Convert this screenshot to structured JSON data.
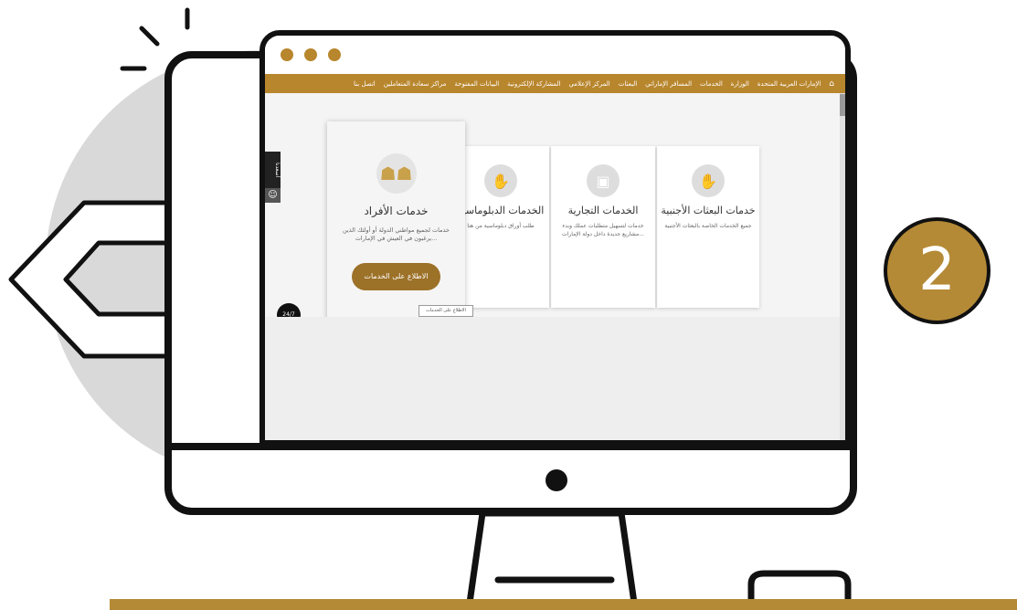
{
  "step_number": "2",
  "nav": {
    "items": [
      "الإمارات العربية المتحدة",
      "الوزارة",
      "الخدمات",
      "المسافر الإماراتي",
      "البعثات",
      "المركز الإعلامي",
      "المشاركة الإلكترونية",
      "البيانات المفتوحة",
      "مراكز سعادة المتعاملين",
      "اتصل بنا"
    ]
  },
  "side_tab_label": "أسعدنا",
  "badge_label": "24/7",
  "cards": [
    {
      "title": "خدمات البعثات الأجنبية",
      "desc": "جميع الخدمات الخاصة بالبعثات الأجنبية",
      "icon": "handshake-icon"
    },
    {
      "title": "الخدمات التجارية",
      "desc": "خدمات لتسهيل متطلبات عملك وبدء مشاريع جديدة داخل دولة الإمارات...",
      "icon": "briefcase-icon"
    },
    {
      "title": "الخدمات الدبلوماسية",
      "desc": "طلب أوراق دبلوماسية من هنا",
      "icon": "handshake-icon"
    }
  ],
  "featured": {
    "title": "خدمات الأفراد",
    "desc": "خدمات لجميع مواطني الدولة أو أولئك الذين يرغبون في العيش في الإمارات...",
    "button": "الاطلاع على الخدمات",
    "tooltip": "الاطلاع على الخدمات",
    "icon": "people-group-icon"
  },
  "colors": {
    "accent": "#b58a36",
    "navbar": "#b8862d",
    "button": "#9c7128",
    "outline": "#111111"
  }
}
